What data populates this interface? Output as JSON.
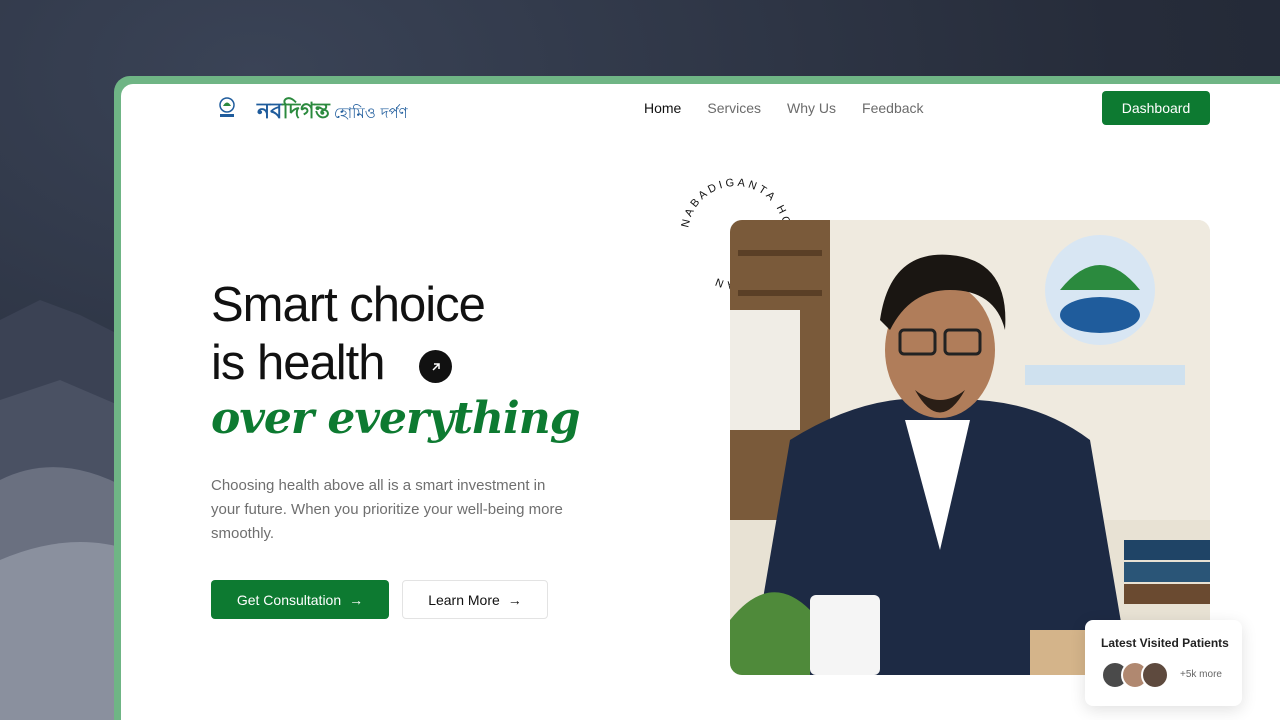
{
  "brand": {
    "name_a": "নব",
    "name_b": "দিগন্ত",
    "name_sub": "হোমিও দর্পণ"
  },
  "nav": [
    "Home",
    "Services",
    "Why Us",
    "Feedback"
  ],
  "header": {
    "dashboard_label": "Dashboard"
  },
  "hero": {
    "line1": "Smart choice",
    "line2": "is health",
    "line3": "over everything",
    "description": "Choosing health above all is a smart investment in your future. When you prioritize your well-being more smoothly.",
    "primary_cta": "Get Consultation",
    "secondary_cta": "Learn More"
  },
  "badge_ring_text": "NABADIGANTA HOMEO DARPAN",
  "patients": {
    "title": "Latest Visited Patients",
    "more": "+5k more"
  },
  "colors": {
    "accent": "#0d7a31",
    "brand_blue": "#1f5c9c",
    "frame": "#6fb585"
  }
}
